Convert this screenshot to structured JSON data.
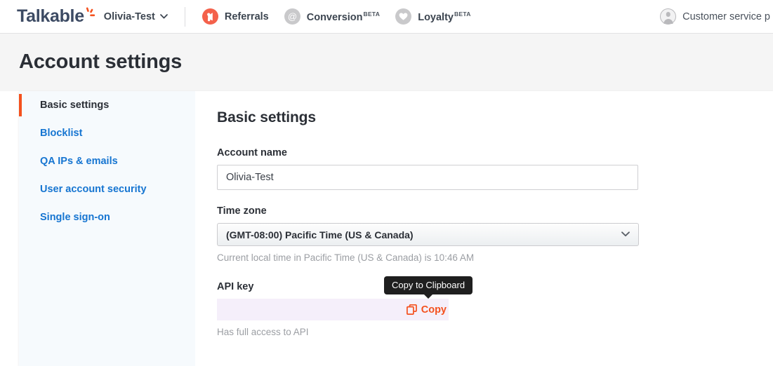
{
  "topbar": {
    "logo_text": "Talkable",
    "logo_icon": "talkable-spark-logo",
    "account_switcher": {
      "name": "Olivia-Test",
      "chevron_icon": "chevron-down-icon"
    },
    "nav_items": [
      {
        "label": "Referrals",
        "badge": "",
        "icon": "megaphone-icon",
        "active": true
      },
      {
        "label": "Conversion",
        "badge": "BETA",
        "icon": "at-sign-icon",
        "active": false
      },
      {
        "label": "Loyalty",
        "badge": "BETA",
        "icon": "heart-icon",
        "active": false
      }
    ],
    "customer_service": {
      "label": "Customer service p",
      "icon": "user-avatar-icon"
    }
  },
  "page": {
    "title": "Account settings"
  },
  "sidebar": {
    "items": [
      {
        "label": "Basic settings",
        "active": true
      },
      {
        "label": "Blocklist",
        "active": false
      },
      {
        "label": "QA IPs & emails",
        "active": false
      },
      {
        "label": "User account security",
        "active": false
      },
      {
        "label": "Single sign-on",
        "active": false
      }
    ]
  },
  "main": {
    "section_title": "Basic settings",
    "account_name": {
      "label": "Account name",
      "value": "Olivia-Test",
      "placeholder": "Account name"
    },
    "time_zone": {
      "label": "Time zone",
      "selected": "(GMT-08:00) Pacific Time (US & Canada)",
      "chevron_icon": "chevron-down-icon",
      "helper": "Current local time in Pacific Time (US & Canada) is 10:46 AM"
    },
    "api_key": {
      "label": "API key",
      "value": "",
      "copy_label": "Copy",
      "copy_icon": "copy-icon",
      "tooltip": "Copy to Clipboard",
      "helper": "Has full access to API"
    }
  },
  "colors": {
    "brand_orange": "#f4511e",
    "referral_coral": "#f4614b",
    "link_blue": "#1675d1",
    "logo_navy": "#3c4a63",
    "sidebar_bg": "#f6fafd",
    "apikey_bg": "#f5effa",
    "tooltip_bg": "#1f1f1f"
  }
}
